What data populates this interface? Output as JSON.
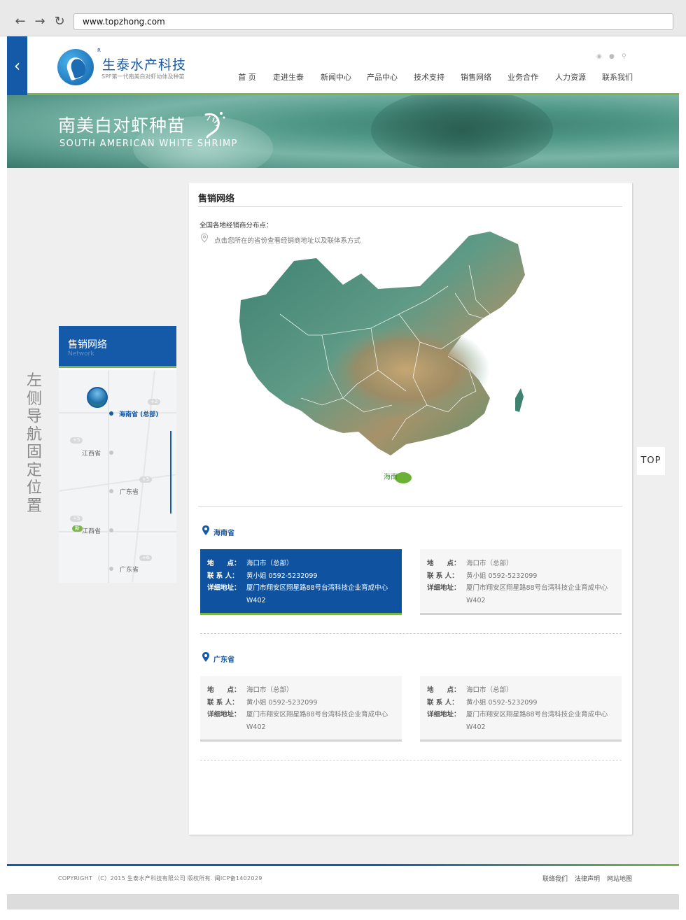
{
  "browser": {
    "url": "www.topzhong.com",
    "back_icon": "arrow-left",
    "forward_icon": "arrow-right",
    "reload_icon": "reload"
  },
  "header": {
    "logo_title": "生泰水产科技",
    "logo_registered": "R",
    "logo_subtitle": "SPF第一代南美白对虾幼体及种苗",
    "icons": [
      "weibo-icon",
      "qq-icon",
      "search-icon"
    ],
    "menu": [
      "首 页",
      "走进生泰",
      "新闻中心",
      "产品中心",
      "技术支持",
      "销售网络",
      "业务合作",
      "人力资源",
      "联系我们"
    ]
  },
  "banner": {
    "title_cn": "南美白对虾种苗",
    "title_en": "SOUTH AMERICAN  WHITE    SHRIMP"
  },
  "left_note": "左侧 导航固定位置",
  "side_nav": {
    "title": "售销网络",
    "subtitle": "Network",
    "items": [
      {
        "label": "海南省 (总部)",
        "badge": "+2",
        "active": true
      },
      {
        "label": "江西省",
        "badge": "+5",
        "active": false
      },
      {
        "label": "广东省",
        "badge": "+5",
        "active": false
      },
      {
        "label": "江西省",
        "badge": "+5",
        "active": false,
        "new_tag": "新"
      },
      {
        "label": "广东省",
        "badge": "+6",
        "active": false
      }
    ]
  },
  "content": {
    "title": "售销网络",
    "dist_label": "全国各地经销商分布点：",
    "dist_hint": "点击您所在的省份查看经销商地址以及联体系方式",
    "map_marker_label": "海南",
    "sections": [
      {
        "title": "海南省",
        "cards": [
          {
            "active": true,
            "addr_k": "地　　点：",
            "addr_v": "海口市（总部）",
            "contact_k": "联 系 人：",
            "contact_v": "黄小姐 0592-5232099",
            "detail_k": "详细地址：",
            "detail_v": "厦门市翔安区翔星路88号台湾科技企业育成中心W402"
          },
          {
            "active": false,
            "addr_k": "地　　点：",
            "addr_v": "海口市（总部）",
            "contact_k": "联 系 人：",
            "contact_v": "黄小姐 0592-5232099",
            "detail_k": "详细地址：",
            "detail_v": "厦门市翔安区翔星路88号台湾科技企业育成中心W402"
          }
        ]
      },
      {
        "title": "广东省",
        "cards": [
          {
            "active": false,
            "addr_k": "地　　点：",
            "addr_v": "海口市（总部）",
            "contact_k": "联 系 人：",
            "contact_v": "黄小姐 0592-5232099",
            "detail_k": "详细地址：",
            "detail_v": "厦门市翔安区翔星路88号台湾科技企业育成中心W402"
          },
          {
            "active": false,
            "addr_k": "地　　点：",
            "addr_v": "海口市（总部）",
            "contact_k": "联 系 人：",
            "contact_v": "黄小姐 0592-5232099",
            "detail_k": "详细地址：",
            "detail_v": "厦门市翔安区翔星路88号台湾科技企业育成中心W402"
          }
        ]
      }
    ]
  },
  "top_button": "TOP",
  "footer": {
    "copyright": "COPYRIGHT （C）2015 生泰水产科技有限公司 版权所有. 闽ICP备1402029",
    "links": [
      "联络我们",
      "法律声明",
      "网站地图"
    ]
  },
  "colors": {
    "brand_blue": "#155aa8",
    "accent_green": "#7ab648",
    "background": "#efefef"
  }
}
